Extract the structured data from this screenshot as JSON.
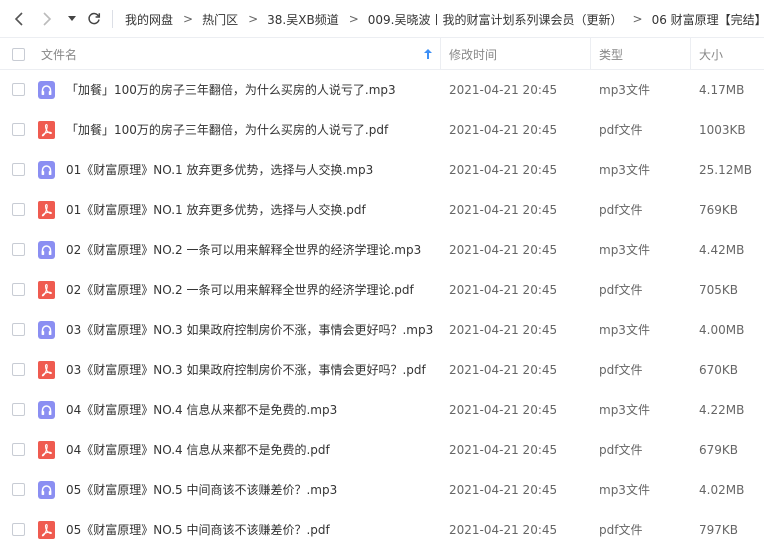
{
  "toolbar": {
    "back_icon": "chevron-left-icon",
    "forward_icon": "chevron-right-icon",
    "dropdown_icon": "caret-down-icon",
    "refresh_icon": "refresh-icon"
  },
  "breadcrumb": {
    "items": [
      "我的网盘",
      "热门区",
      "38.吴XB频道",
      "009.吴晓波丨我的财富计划系列课会员（更新）",
      "06 财富原理【完结】"
    ],
    "separator": ">"
  },
  "columns": {
    "name": "文件名",
    "time": "修改时间",
    "type": "类型",
    "size": "大小",
    "sort_icon": "sort-arrow-up-icon"
  },
  "colors": {
    "audio_icon": "#8b8ff2",
    "pdf_icon": "#ef5b50",
    "accent": "#3d8ff5"
  },
  "files": [
    {
      "name": "「加餐」100万的房子三年翻倍，为什么买房的人说亏了.mp3",
      "time": "2021-04-21 20:45",
      "type": "mp3文件",
      "size": "4.17MB",
      "icon": "audio"
    },
    {
      "name": "「加餐」100万的房子三年翻倍，为什么买房的人说亏了.pdf",
      "time": "2021-04-21 20:45",
      "type": "pdf文件",
      "size": "1003KB",
      "icon": "pdf"
    },
    {
      "name": "01《财富原理》NO.1 放弃更多优势，选择与人交换.mp3",
      "time": "2021-04-21 20:45",
      "type": "mp3文件",
      "size": "25.12MB",
      "icon": "audio"
    },
    {
      "name": "01《财富原理》NO.1 放弃更多优势，选择与人交换.pdf",
      "time": "2021-04-21 20:45",
      "type": "pdf文件",
      "size": "769KB",
      "icon": "pdf"
    },
    {
      "name": "02《财富原理》NO.2 一条可以用来解释全世界的经济学理论.mp3",
      "time": "2021-04-21 20:45",
      "type": "mp3文件",
      "size": "4.42MB",
      "icon": "audio"
    },
    {
      "name": "02《财富原理》NO.2 一条可以用来解释全世界的经济学理论.pdf",
      "time": "2021-04-21 20:45",
      "type": "pdf文件",
      "size": "705KB",
      "icon": "pdf"
    },
    {
      "name": "03《财富原理》NO.3 如果政府控制房价不涨，事情会更好吗？.mp3",
      "time": "2021-04-21 20:45",
      "type": "mp3文件",
      "size": "4.00MB",
      "icon": "audio"
    },
    {
      "name": "03《财富原理》NO.3 如果政府控制房价不涨，事情会更好吗？.pdf",
      "time": "2021-04-21 20:45",
      "type": "pdf文件",
      "size": "670KB",
      "icon": "pdf"
    },
    {
      "name": "04《财富原理》NO.4 信息从来都不是免费的.mp3",
      "time": "2021-04-21 20:45",
      "type": "mp3文件",
      "size": "4.22MB",
      "icon": "audio"
    },
    {
      "name": "04《财富原理》NO.4 信息从来都不是免费的.pdf",
      "time": "2021-04-21 20:45",
      "type": "pdf文件",
      "size": "679KB",
      "icon": "pdf"
    },
    {
      "name": "05《财富原理》NO.5 中间商该不该赚差价？.mp3",
      "time": "2021-04-21 20:45",
      "type": "mp3文件",
      "size": "4.02MB",
      "icon": "audio"
    },
    {
      "name": "05《财富原理》NO.5 中间商该不该赚差价？.pdf",
      "time": "2021-04-21 20:45",
      "type": "pdf文件",
      "size": "797KB",
      "icon": "pdf"
    }
  ]
}
